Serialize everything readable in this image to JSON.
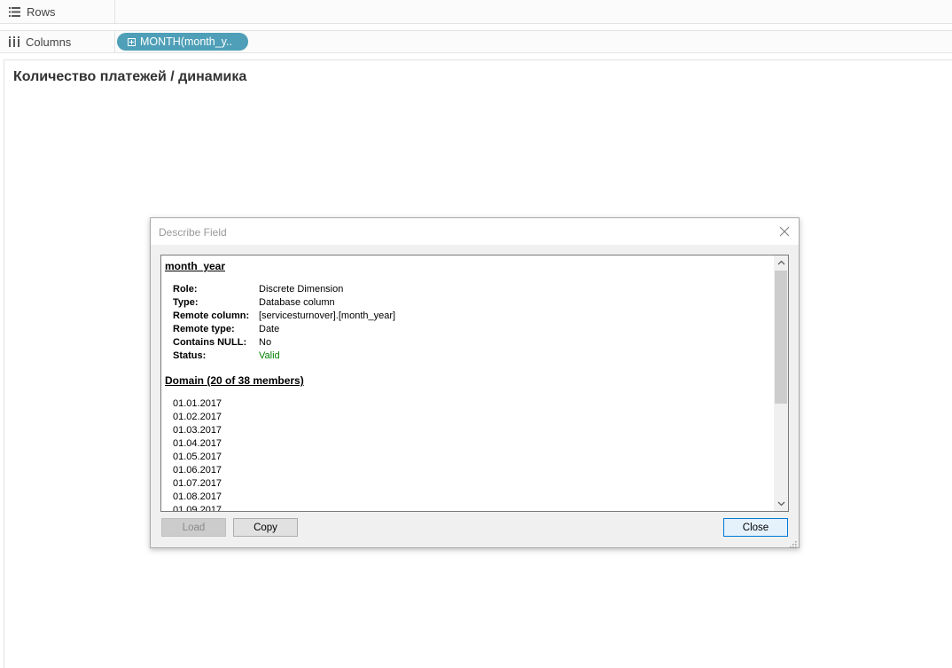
{
  "shelves": {
    "rows_label": "Rows",
    "columns_label": "Columns",
    "columns_pill": "MONTH(month_y.."
  },
  "sheet": {
    "title": "Количество платежей / динамика"
  },
  "dialog": {
    "title": "Describe Field",
    "field_name": "month_year",
    "properties": [
      {
        "key": "Role:",
        "value": "Discrete Dimension"
      },
      {
        "key": "Type:",
        "value": "Database column"
      },
      {
        "key": "Remote column:",
        "value": "[servicesturnover].[month_year]"
      },
      {
        "key": "Remote type:",
        "value": "Date"
      },
      {
        "key": "Contains NULL:",
        "value": "No"
      },
      {
        "key": "Status:",
        "value": "Valid"
      }
    ],
    "domain_heading": "Domain (20 of 38 members)",
    "domain_members": [
      "01.01.2017",
      "01.02.2017",
      "01.03.2017",
      "01.04.2017",
      "01.05.2017",
      "01.06.2017",
      "01.07.2017",
      "01.08.2017",
      "01.09.2017"
    ],
    "buttons": {
      "load": "Load",
      "copy": "Copy",
      "close": "Close"
    }
  },
  "colors": {
    "pill": "#4e9fb7",
    "valid": "#008000",
    "close_focus": "#0078d7"
  }
}
